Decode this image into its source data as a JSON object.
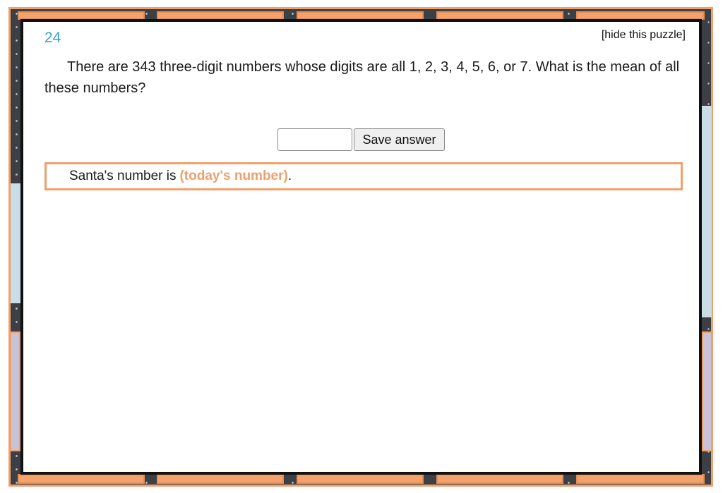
{
  "puzzle": {
    "number": "24",
    "hide_label": "[hide this puzzle]",
    "question": "There are 343 three-digit numbers whose digits are all 1, 2, 3, 4, 5, 6, or 7. What is the mean of all these numbers?"
  },
  "answer": {
    "input_value": "",
    "save_label": "Save answer"
  },
  "santa": {
    "prefix": "Santa's number is",
    "value": "(today's number)",
    "suffix": "."
  },
  "colors": {
    "accent_orange": "#f0a06c",
    "number_blue": "#3aa0c8",
    "card_border": "#111111"
  }
}
